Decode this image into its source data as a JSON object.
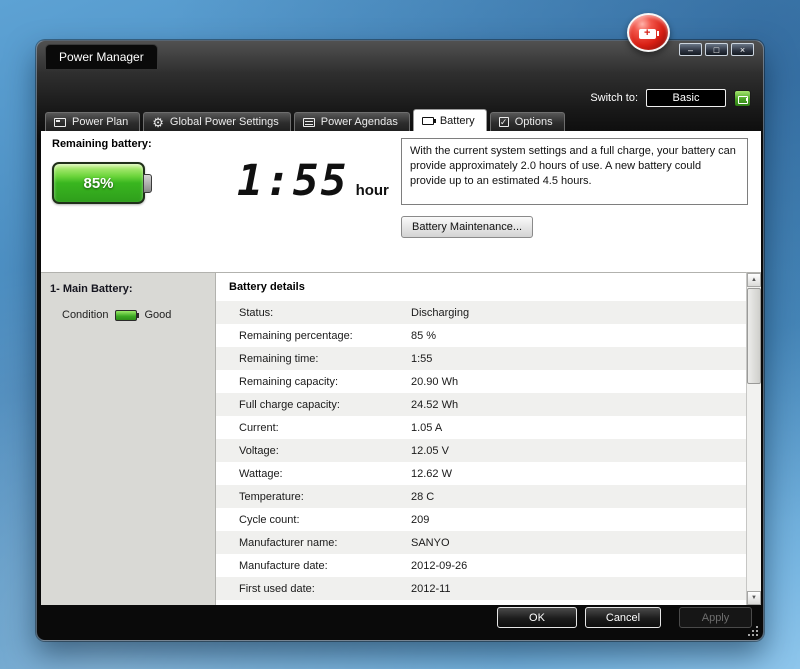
{
  "window": {
    "title": "Power Manager",
    "controls": {
      "minimize_icon": "–",
      "maximize_icon": "□",
      "close_icon": "×"
    }
  },
  "header": {
    "switch_label": "Switch to:",
    "switch_button_label": "Basic"
  },
  "icons": {
    "gear": "⚙",
    "check": "✓",
    "scroll_up": "▲",
    "scroll_down": "▼"
  },
  "tabs": [
    {
      "label": "Power Plan",
      "icon": "document-icon"
    },
    {
      "label": "Global Power Settings",
      "icon": "gear-icon"
    },
    {
      "label": "Power Agendas",
      "icon": "calendar-icon"
    },
    {
      "label": "Battery",
      "icon": "battery-icon",
      "active": true
    },
    {
      "label": "Options",
      "icon": "checkbox-icon"
    }
  ],
  "summary": {
    "heading": "Remaining battery:",
    "battery_percent": "85%",
    "time_value": "1:55",
    "time_unit": "hour",
    "description": "With the current system settings and a full charge, your battery can provide approximately 2.0 hours of use. A new battery could provide up to an estimated 4.5 hours.",
    "maintenance_button_label": "Battery Maintenance..."
  },
  "sidebar": {
    "battery_title": "1- Main Battery:",
    "condition_label": "Condition",
    "condition_value": "Good"
  },
  "details": {
    "heading": "Battery details",
    "rows": [
      {
        "label": "Status:",
        "value": "Discharging"
      },
      {
        "label": "Remaining percentage:",
        "value": "85 %"
      },
      {
        "label": "Remaining time:",
        "value": "1:55"
      },
      {
        "label": "Remaining capacity:",
        "value": "20.90 Wh"
      },
      {
        "label": "Full charge capacity:",
        "value": "24.52 Wh"
      },
      {
        "label": "Current:",
        "value": "1.05 A"
      },
      {
        "label": "Voltage:",
        "value": "12.05 V"
      },
      {
        "label": "Wattage:",
        "value": "12.62 W"
      },
      {
        "label": "Temperature:",
        "value": "28 C"
      },
      {
        "label": "Cycle count:",
        "value": "209"
      },
      {
        "label": "Manufacturer name:",
        "value": "SANYO"
      },
      {
        "label": "Manufacture date:",
        "value": "2012-09-26"
      },
      {
        "label": "First used date:",
        "value": "2012-11"
      }
    ]
  },
  "footer": {
    "ok_label": "OK",
    "cancel_label": "Cancel",
    "apply_label": "Apply"
  },
  "colors": {
    "battery_green": "#39b61f",
    "desktop_blue": "#4586ba",
    "alert_red": "#d81f14",
    "window_dark": "#0a0a0a"
  }
}
